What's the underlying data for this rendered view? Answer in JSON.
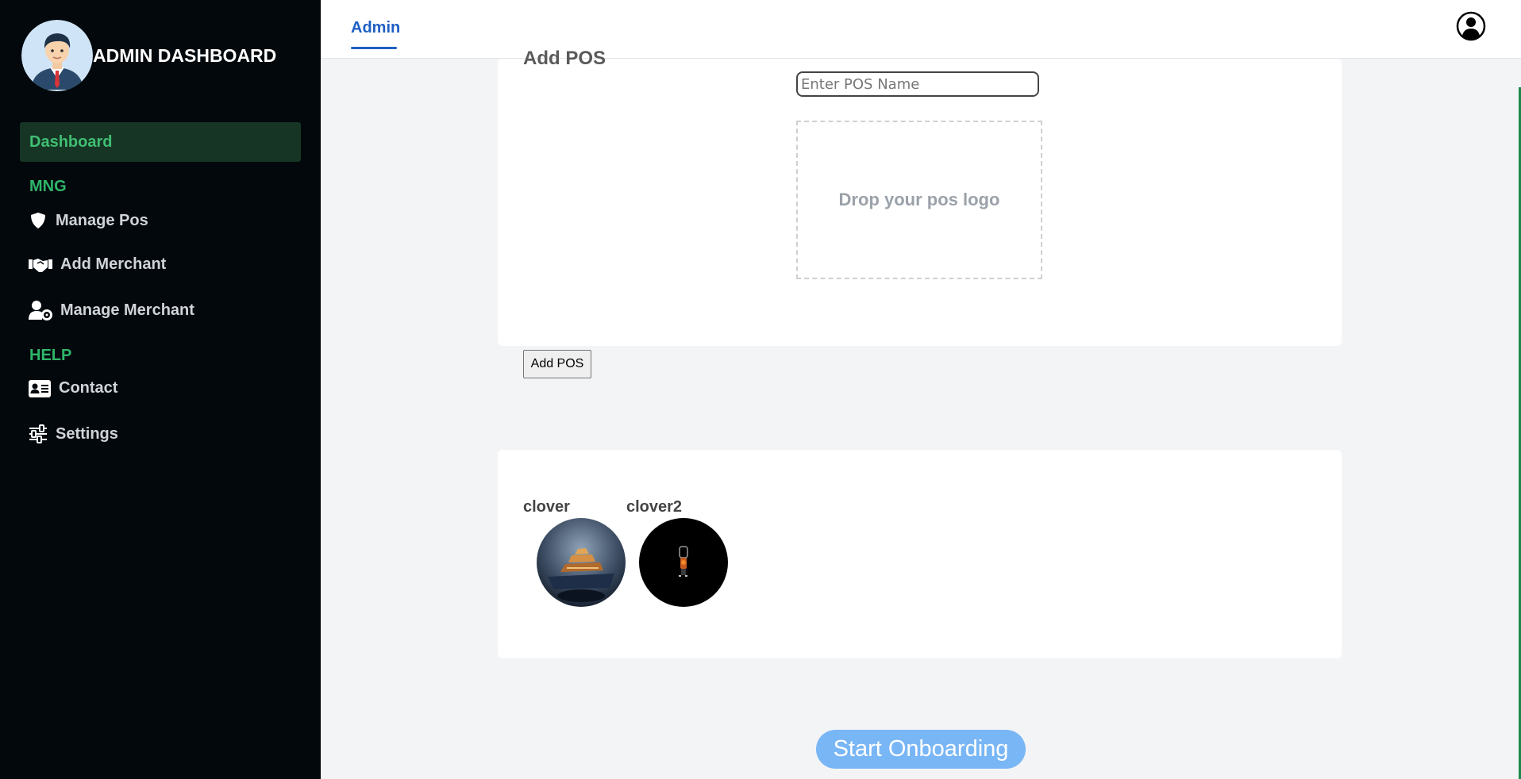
{
  "sidebar": {
    "brand_title": "ADMIN DASHBOARD",
    "active_item": "Dashboard",
    "sections": [
      {
        "heading": "MNG",
        "items": [
          {
            "label": "Manage Pos",
            "icon": "shield-icon"
          },
          {
            "label": "Add Merchant",
            "icon": "handshake-icon"
          },
          {
            "label": "Manage Merchant",
            "icon": "user-gear-icon"
          }
        ]
      },
      {
        "heading": "HELP",
        "items": [
          {
            "label": "Contact",
            "icon": "contact-card-icon"
          },
          {
            "label": "Settings",
            "icon": "sliders-icon"
          }
        ]
      }
    ]
  },
  "header": {
    "tab_label": "Admin",
    "user_icon": "user-circle-icon"
  },
  "add_pos": {
    "heading": "Add POS",
    "name_placeholder": "Enter POS Name",
    "dropzone_text": "Drop your pos logo",
    "submit_label": "Add POS"
  },
  "pos_list": [
    {
      "name": "clover"
    },
    {
      "name": "clover2"
    }
  ],
  "start_onboarding_label": "Start Onboarding",
  "colors": {
    "sidebar_bg": "#02080c",
    "accent_green": "#2fb56a",
    "tab_blue": "#1f5fc4",
    "onboarding_button": "#79b6f5"
  }
}
